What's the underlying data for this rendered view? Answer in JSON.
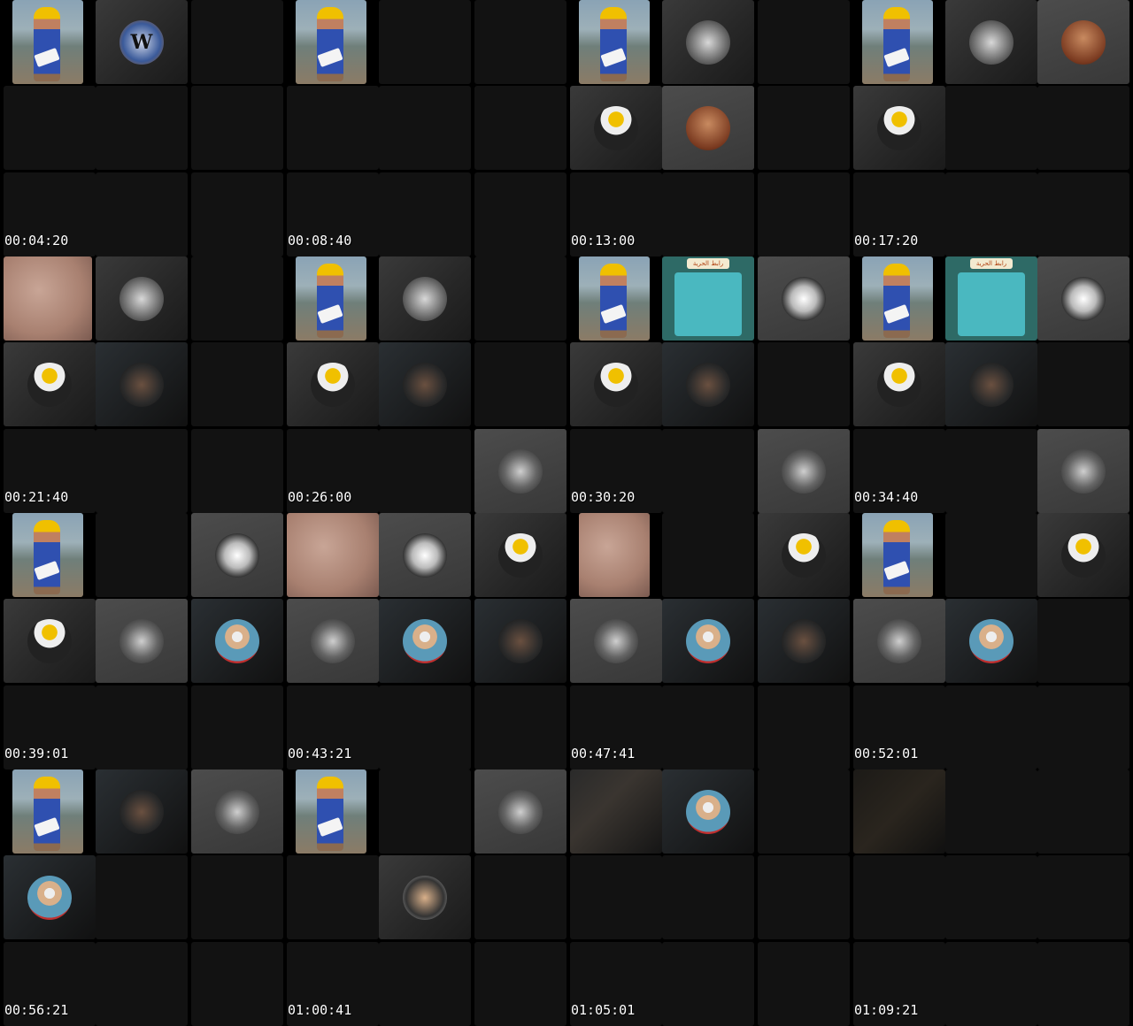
{
  "timestamps": [
    "00:04:20",
    "00:08:40",
    "00:13:00",
    "00:17:20",
    "00:21:40",
    "00:26:00",
    "00:30:20",
    "00:34:40",
    "00:39:01",
    "00:43:21",
    "00:47:41",
    "00:52:01",
    "00:56:21",
    "01:00:41",
    "01:05:01",
    "01:09:21"
  ],
  "teal_label": "رابط الحرية"
}
